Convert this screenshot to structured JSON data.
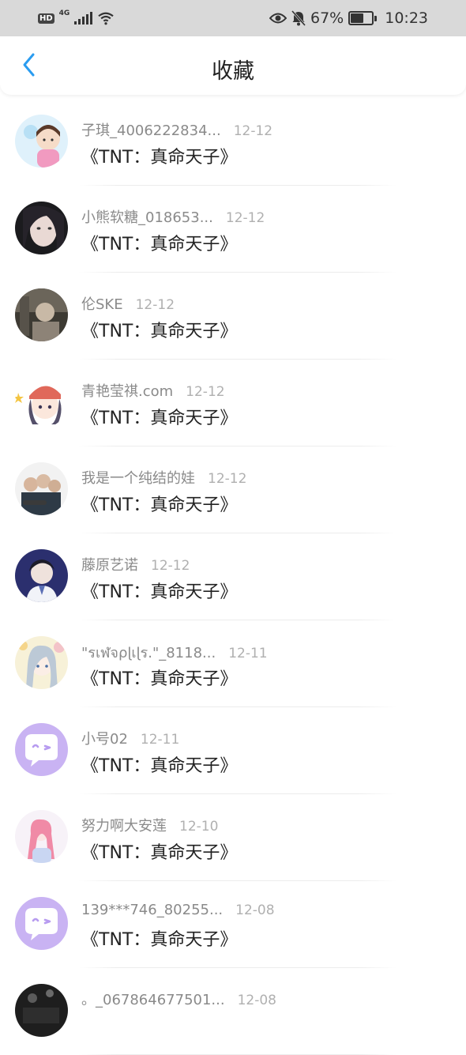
{
  "status_bar": {
    "hd": "HD",
    "network": "4G",
    "battery": "67%",
    "battery_level": 0.67,
    "time": "10:23"
  },
  "header": {
    "title": "收藏"
  },
  "colors": {
    "accent": "#2a9cf0",
    "status_bg": "#d9d9d9"
  },
  "items": [
    {
      "name": "子琪_4006222834...",
      "date": "12-12",
      "title": "《TNT：真命天子》",
      "avatar": "cartoon-girl"
    },
    {
      "name": "小熊软糖_018653...",
      "date": "12-12",
      "title": "《TNT：真命天子》",
      "avatar": "photo-girl"
    },
    {
      "name": "伦SKE",
      "date": "12-12",
      "title": "《TNT：真命天子》",
      "avatar": "photo-person"
    },
    {
      "name": "青艳莹祺.com",
      "date": "12-12",
      "title": "《TNT：真命天子》",
      "avatar": "cartoon-red-hat"
    },
    {
      "name": "我是一个纯结的娃",
      "date": "12-12",
      "title": "《TNT：真命天子》",
      "avatar": "photo-group"
    },
    {
      "name": "藤原艺诺",
      "date": "12-12",
      "title": "《TNT：真命天子》",
      "avatar": "photo-boy"
    },
    {
      "name": "\"รเฬจρɭเɭร.\"_8118...",
      "date": "12-11",
      "title": "《TNT：真命天子》",
      "avatar": "illustration-girl"
    },
    {
      "name": "小号02",
      "date": "12-11",
      "title": "《TNT：真命天子》",
      "avatar": "default-chat"
    },
    {
      "name": "努力啊大安莲",
      "date": "12-10",
      "title": "《TNT：真命天子》",
      "avatar": "illustration-pink"
    },
    {
      "name": "139***746_80255...",
      "date": "12-08",
      "title": "《TNT：真命天子》",
      "avatar": "default-chat"
    },
    {
      "name": "。_067864677501...",
      "date": "12-08",
      "title": "",
      "avatar": "photo-dark"
    }
  ]
}
